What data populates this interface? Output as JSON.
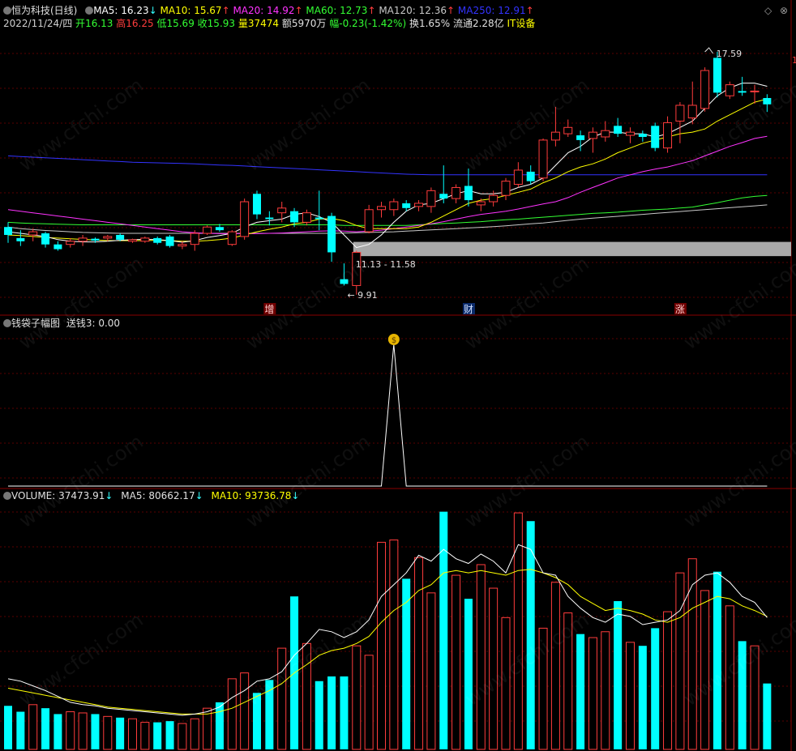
{
  "header": {
    "stock": "恒为科技(日线)",
    "ma5": "MA5: 16.23",
    "ma10": "MA10: 15.67",
    "ma20": "MA20: 14.92",
    "ma60": "MA60: 12.73",
    "ma120": "MA120: 12.36",
    "ma250": "MA250: 12.91",
    "date": "2022/11/24/四",
    "open_label": "开",
    "open": "16.13",
    "high_label": "高",
    "high": "16.25",
    "low_label": "低",
    "low": "15.69",
    "close_label": "收",
    "close": "15.93",
    "vol_label": "量",
    "vol": "37474",
    "amount": "额5970万",
    "change_label": "幅",
    "change": "-0.23(-1.42%)",
    "turnover": "换1.65%",
    "float_cap": "流通2.28亿",
    "sector": "IT设备"
  },
  "annotations": {
    "high_mark": "17.59",
    "low_mark": "9.91",
    "range": "11.13 - 11.58",
    "right_edge": "1"
  },
  "markers": [
    "增",
    "财",
    "涨"
  ],
  "indicator": {
    "title": "钱袋子幅图",
    "value": "送钱3: 0.00",
    "coin": "$"
  },
  "volume": {
    "vol": "VOLUME: 37473.91",
    "ma5": "MA5: 80662.17",
    "ma10": "MA10: 93736.78"
  },
  "watermark": "www.cfchi.com",
  "colors": {
    "up": "#ff3c3c",
    "down": "#00ffff",
    "ma5": "#ffffff",
    "ma10": "#ffff00",
    "ma20": "#ff33ff",
    "ma60": "#33ff33",
    "ma120": "#c8c8c8",
    "ma250": "#3333ff",
    "grid": "#5a0000"
  },
  "chart_data": [
    {
      "type": "candlestick",
      "title": "恒为科技(日线)",
      "candles": [
        {
          "o": 12.05,
          "h": 12.2,
          "l": 11.55,
          "c": 11.8
        },
        {
          "o": 11.7,
          "h": 11.95,
          "l": 11.45,
          "c": 11.6
        },
        {
          "o": 11.8,
          "h": 12.0,
          "l": 11.6,
          "c": 11.9
        },
        {
          "o": 11.85,
          "h": 11.9,
          "l": 11.4,
          "c": 11.5
        },
        {
          "o": 11.5,
          "h": 11.6,
          "l": 11.3,
          "c": 11.35
        },
        {
          "o": 11.5,
          "h": 11.7,
          "l": 11.4,
          "c": 11.6
        },
        {
          "o": 11.6,
          "h": 11.8,
          "l": 11.45,
          "c": 11.7
        },
        {
          "o": 11.68,
          "h": 11.72,
          "l": 11.55,
          "c": 11.62
        },
        {
          "o": 11.7,
          "h": 11.8,
          "l": 11.6,
          "c": 11.75
        },
        {
          "o": 11.8,
          "h": 11.85,
          "l": 11.6,
          "c": 11.65
        },
        {
          "o": 11.6,
          "h": 11.68,
          "l": 11.55,
          "c": 11.65
        },
        {
          "o": 11.6,
          "h": 11.75,
          "l": 11.55,
          "c": 11.7
        },
        {
          "o": 11.7,
          "h": 11.75,
          "l": 11.5,
          "c": 11.55
        },
        {
          "o": 11.75,
          "h": 11.8,
          "l": 11.4,
          "c": 11.45
        },
        {
          "o": 11.45,
          "h": 11.6,
          "l": 11.35,
          "c": 11.5
        },
        {
          "o": 11.5,
          "h": 11.95,
          "l": 11.3,
          "c": 11.85
        },
        {
          "o": 11.85,
          "h": 12.1,
          "l": 11.8,
          "c": 12.05
        },
        {
          "o": 12.05,
          "h": 12.15,
          "l": 11.9,
          "c": 11.95
        },
        {
          "o": 11.5,
          "h": 11.95,
          "l": 11.45,
          "c": 11.9
        },
        {
          "o": 11.75,
          "h": 12.95,
          "l": 11.65,
          "c": 12.85
        },
        {
          "o": 13.1,
          "h": 13.2,
          "l": 12.3,
          "c": 12.45
        },
        {
          "o": 12.35,
          "h": 12.55,
          "l": 12.1,
          "c": 12.3
        },
        {
          "o": 12.5,
          "h": 12.85,
          "l": 12.2,
          "c": 12.65
        },
        {
          "o": 12.55,
          "h": 12.65,
          "l": 12.05,
          "c": 12.2
        },
        {
          "o": 12.2,
          "h": 12.6,
          "l": 12.1,
          "c": 12.5
        },
        {
          "o": 12.35,
          "h": 13.2,
          "l": 11.95,
          "c": 12.3
        },
        {
          "o": 12.4,
          "h": 12.5,
          "l": 10.95,
          "c": 11.25
        },
        {
          "o": 10.4,
          "h": 10.9,
          "l": 10.2,
          "c": 10.25
        },
        {
          "o": 10.2,
          "h": 11.3,
          "l": 9.91,
          "c": 11.25
        },
        {
          "o": 11.9,
          "h": 12.75,
          "l": 11.85,
          "c": 12.6
        },
        {
          "o": 12.6,
          "h": 12.85,
          "l": 12.35,
          "c": 12.7
        },
        {
          "o": 12.6,
          "h": 12.95,
          "l": 12.4,
          "c": 12.85
        },
        {
          "o": 12.8,
          "h": 12.9,
          "l": 12.55,
          "c": 12.65
        },
        {
          "o": 12.7,
          "h": 12.9,
          "l": 12.55,
          "c": 12.8
        },
        {
          "o": 12.7,
          "h": 13.3,
          "l": 12.5,
          "c": 13.2
        },
        {
          "o": 13.1,
          "h": 14.0,
          "l": 12.8,
          "c": 12.95
        },
        {
          "o": 12.95,
          "h": 13.4,
          "l": 12.8,
          "c": 13.3
        },
        {
          "o": 13.35,
          "h": 13.9,
          "l": 12.7,
          "c": 12.9
        },
        {
          "o": 12.75,
          "h": 12.95,
          "l": 12.55,
          "c": 12.85
        },
        {
          "o": 12.85,
          "h": 13.2,
          "l": 12.7,
          "c": 13.05
        },
        {
          "o": 13.05,
          "h": 13.6,
          "l": 12.9,
          "c": 13.5
        },
        {
          "o": 13.4,
          "h": 14.1,
          "l": 13.3,
          "c": 13.85
        },
        {
          "o": 13.8,
          "h": 14.0,
          "l": 13.4,
          "c": 13.5
        },
        {
          "o": 13.6,
          "h": 14.85,
          "l": 13.5,
          "c": 14.8
        },
        {
          "o": 14.8,
          "h": 15.85,
          "l": 14.6,
          "c": 15.05
        },
        {
          "o": 15.0,
          "h": 15.45,
          "l": 14.9,
          "c": 15.2
        },
        {
          "o": 14.95,
          "h": 15.1,
          "l": 14.45,
          "c": 14.8
        },
        {
          "o": 14.85,
          "h": 15.2,
          "l": 14.4,
          "c": 15.05
        },
        {
          "o": 14.9,
          "h": 15.4,
          "l": 14.75,
          "c": 15.1
        },
        {
          "o": 15.25,
          "h": 15.5,
          "l": 14.9,
          "c": 15.0
        },
        {
          "o": 14.95,
          "h": 15.2,
          "l": 14.7,
          "c": 15.05
        },
        {
          "o": 15.0,
          "h": 15.1,
          "l": 14.75,
          "c": 14.9
        },
        {
          "o": 15.25,
          "h": 15.35,
          "l": 14.45,
          "c": 14.55
        },
        {
          "o": 14.55,
          "h": 15.55,
          "l": 14.4,
          "c": 15.35
        },
        {
          "o": 15.4,
          "h": 16.0,
          "l": 14.7,
          "c": 15.9
        },
        {
          "o": 15.5,
          "h": 16.65,
          "l": 15.3,
          "c": 15.9
        },
        {
          "o": 15.8,
          "h": 17.1,
          "l": 15.7,
          "c": 17.0
        },
        {
          "o": 17.4,
          "h": 17.59,
          "l": 16.15,
          "c": 16.3
        },
        {
          "o": 16.2,
          "h": 16.65,
          "l": 16.1,
          "c": 16.55
        },
        {
          "o": 16.35,
          "h": 16.8,
          "l": 16.2,
          "c": 16.3
        },
        {
          "o": 16.35,
          "h": 16.55,
          "l": 15.95,
          "c": 16.35
        },
        {
          "o": 16.13,
          "h": 16.25,
          "l": 15.69,
          "c": 15.93
        }
      ],
      "ma_lines": {
        "MA5": [
          11.9,
          11.85,
          11.8,
          11.75,
          11.65,
          11.6,
          11.58,
          11.58,
          11.6,
          11.63,
          11.65,
          11.66,
          11.65,
          11.62,
          11.57,
          11.62,
          11.72,
          11.78,
          11.85,
          12.05,
          12.2,
          12.25,
          12.3,
          12.45,
          12.5,
          12.38,
          12.2,
          11.8,
          11.4,
          11.5,
          11.8,
          12.2,
          12.55,
          12.75,
          12.8,
          12.95,
          13.1,
          13.2,
          13.1,
          13.1,
          13.15,
          13.3,
          13.4,
          13.6,
          14.0,
          14.4,
          14.6,
          14.9,
          15.05,
          15.05,
          15.0,
          15.0,
          14.9,
          15.0,
          15.2,
          15.4,
          15.8,
          16.2,
          16.45,
          16.6,
          16.6,
          16.5
        ],
        "MA10": [
          11.8,
          11.78,
          11.75,
          11.72,
          11.7,
          11.68,
          11.66,
          11.64,
          11.62,
          11.62,
          11.62,
          11.62,
          11.63,
          11.62,
          11.6,
          11.6,
          11.62,
          11.65,
          11.7,
          11.8,
          11.9,
          11.98,
          12.05,
          12.15,
          12.2,
          12.3,
          12.32,
          12.25,
          12.1,
          12.0,
          12.0,
          12.0,
          12.0,
          12.05,
          12.2,
          12.4,
          12.6,
          12.8,
          12.9,
          12.95,
          13.05,
          13.15,
          13.25,
          13.45,
          13.6,
          13.8,
          13.95,
          14.05,
          14.2,
          14.4,
          14.55,
          14.7,
          14.8,
          14.9,
          15.0,
          15.05,
          15.15,
          15.4,
          15.6,
          15.8,
          16.0,
          16.1
        ],
        "MA20": [
          12.6,
          12.55,
          12.5,
          12.45,
          12.4,
          12.35,
          12.3,
          12.25,
          12.2,
          12.15,
          12.1,
          12.05,
          12.0,
          11.95,
          11.9,
          11.87,
          11.85,
          11.84,
          11.84,
          11.84,
          11.84,
          11.85,
          11.86,
          11.88,
          11.9,
          11.92,
          11.93,
          11.92,
          11.9,
          11.92,
          11.95,
          12.0,
          12.05,
          12.1,
          12.15,
          12.22,
          12.3,
          12.38,
          12.45,
          12.5,
          12.55,
          12.62,
          12.7,
          12.78,
          12.85,
          12.98,
          13.15,
          13.3,
          13.45,
          13.6,
          13.7,
          13.8,
          13.88,
          13.95,
          14.05,
          14.15,
          14.3,
          14.45,
          14.6,
          14.72,
          14.85,
          14.92
        ],
        "MA60": [
          12.2,
          12.18,
          12.16,
          12.15,
          12.14,
          12.13,
          12.12,
          12.12,
          12.12,
          12.12,
          12.12,
          12.12,
          12.12,
          12.12,
          12.12,
          12.12,
          12.12,
          12.12,
          12.12,
          12.12,
          12.12,
          12.12,
          12.12,
          12.12,
          12.12,
          12.12,
          12.12,
          12.1,
          12.1,
          12.1,
          12.1,
          12.1,
          12.1,
          12.12,
          12.14,
          12.16,
          12.18,
          12.2,
          12.22,
          12.25,
          12.28,
          12.3,
          12.33,
          12.36,
          12.39,
          12.42,
          12.45,
          12.48,
          12.5,
          12.52,
          12.55,
          12.58,
          12.6,
          12.62,
          12.65,
          12.68,
          12.75,
          12.82,
          12.9,
          12.97,
          13.02,
          13.05
        ],
        "MA120": [
          12.05,
          12.0,
          11.97,
          11.94,
          11.92,
          11.9,
          11.88,
          11.87,
          11.86,
          11.85,
          11.85,
          11.85,
          11.85,
          11.85,
          11.85,
          11.85,
          11.85,
          11.85,
          11.85,
          11.85,
          11.85,
          11.85,
          11.85,
          11.85,
          11.85,
          11.85,
          11.85,
          11.86,
          11.87,
          11.88,
          11.89,
          11.9,
          11.92,
          11.94,
          11.96,
          11.98,
          12.0,
          12.02,
          12.04,
          12.06,
          12.09,
          12.12,
          12.15,
          12.18,
          12.22,
          12.26,
          12.3,
          12.33,
          12.36,
          12.39,
          12.42,
          12.45,
          12.48,
          12.51,
          12.54,
          12.57,
          12.6,
          12.63,
          12.66,
          12.69,
          12.72,
          12.75
        ],
        "MA250": [
          14.3,
          14.28,
          14.26,
          14.24,
          14.22,
          14.2,
          14.18,
          14.16,
          14.14,
          14.12,
          14.1,
          14.09,
          14.08,
          14.07,
          14.06,
          14.05,
          14.03,
          14.01,
          14.0,
          13.98,
          13.96,
          13.94,
          13.92,
          13.9,
          13.88,
          13.86,
          13.84,
          13.82,
          13.8,
          13.78,
          13.76,
          13.74,
          13.72,
          13.71,
          13.7,
          13.7,
          13.7,
          13.7,
          13.7,
          13.7,
          13.7,
          13.7,
          13.7,
          13.7,
          13.7,
          13.7,
          13.7,
          13.7,
          13.7,
          13.7,
          13.7,
          13.7,
          13.7,
          13.7,
          13.7,
          13.7,
          13.7,
          13.7,
          13.7,
          13.7,
          13.7,
          13.7
        ]
      },
      "ylim": [
        9.75,
        18.0
      ],
      "band": [
        11.13,
        11.58
      ]
    },
    {
      "type": "line",
      "title": "钱袋子幅图",
      "series": [
        {
          "name": "送钱3",
          "values": [
            0,
            0,
            0,
            0,
            0,
            0,
            0,
            0,
            0,
            0,
            0,
            0,
            0,
            0,
            0,
            0,
            0,
            0,
            0,
            0,
            0,
            0,
            0,
            0,
            0,
            0,
            0,
            0,
            0,
            0,
            0,
            1,
            0,
            0,
            0,
            0,
            0,
            0,
            0,
            0,
            0,
            0,
            0,
            0,
            0,
            0,
            0,
            0,
            0,
            0,
            0,
            0,
            0,
            0,
            0,
            0,
            0,
            0,
            0,
            0,
            0,
            0
          ]
        }
      ]
    },
    {
      "type": "bar",
      "title": "VOLUME",
      "values": [
        37,
        32,
        38,
        35,
        30,
        32,
        31,
        30,
        28,
        27,
        26,
        23,
        23,
        24,
        22,
        26,
        35,
        40,
        60,
        65,
        48,
        59,
        86,
        130,
        90,
        58,
        62,
        62,
        88,
        80,
        176,
        178,
        145,
        163,
        133,
        202,
        148,
        128,
        157,
        137,
        112,
        201,
        194,
        103,
        142,
        116,
        98,
        95,
        100,
        126,
        91,
        88,
        103,
        117,
        150,
        162,
        135,
        151,
        122,
        92,
        88,
        56
      ],
      "ma5": [
        60,
        58,
        54,
        50,
        45,
        40,
        38,
        37,
        35,
        34,
        33,
        32,
        31,
        30,
        29,
        30,
        32,
        36,
        44,
        50,
        58,
        60,
        66,
        80,
        90,
        102,
        100,
        95,
        100,
        110,
        130,
        140,
        150,
        165,
        160,
        170,
        162,
        158,
        166,
        160,
        150,
        174,
        170,
        150,
        148,
        130,
        120,
        112,
        108,
        115,
        113,
        106,
        108,
        110,
        118,
        140,
        148,
        150,
        142,
        130,
        125,
        112
      ],
      "ma10": [
        52,
        50,
        48,
        46,
        44,
        42,
        40,
        38,
        36,
        35,
        34,
        33,
        32,
        31,
        30,
        30,
        30,
        32,
        35,
        40,
        45,
        50,
        56,
        65,
        72,
        80,
        84,
        86,
        90,
        96,
        108,
        118,
        125,
        135,
        140,
        150,
        152,
        150,
        152,
        150,
        148,
        152,
        153,
        150,
        146,
        140,
        130,
        124,
        118,
        120,
        118,
        115,
        110,
        108,
        112,
        120,
        125,
        130,
        128,
        122,
        118,
        113
      ]
    }
  ]
}
